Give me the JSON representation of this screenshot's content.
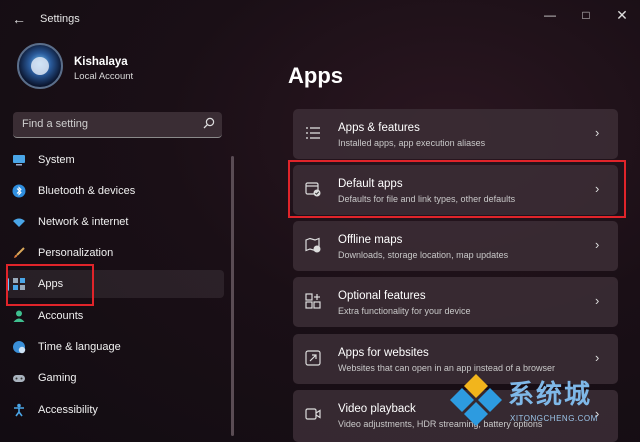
{
  "window": {
    "title": "Settings",
    "back_icon": "back-arrow-icon",
    "controls": [
      "minimize",
      "maximize",
      "close"
    ]
  },
  "profile": {
    "name": "Kishalaya",
    "account_type": "Local Account"
  },
  "search": {
    "placeholder": "Find a setting"
  },
  "nav": {
    "items": [
      {
        "label": "System",
        "icon": "monitor-icon",
        "selected": false
      },
      {
        "label": "Bluetooth & devices",
        "icon": "bluetooth-icon",
        "selected": false
      },
      {
        "label": "Network & internet",
        "icon": "wifi-icon",
        "selected": false
      },
      {
        "label": "Personalization",
        "icon": "brush-icon",
        "selected": false
      },
      {
        "label": "Apps",
        "icon": "apps-icon",
        "selected": true
      },
      {
        "label": "Accounts",
        "icon": "person-icon",
        "selected": false
      },
      {
        "label": "Time & language",
        "icon": "globe-clock-icon",
        "selected": false
      },
      {
        "label": "Gaming",
        "icon": "gamepad-icon",
        "selected": false
      },
      {
        "label": "Accessibility",
        "icon": "accessibility-icon",
        "selected": false
      }
    ]
  },
  "main": {
    "title": "Apps",
    "cards": [
      {
        "title": "Apps & features",
        "subtitle": "Installed apps, app execution aliases",
        "icon": "list-icon"
      },
      {
        "title": "Default apps",
        "subtitle": "Defaults for file and link types, other defaults",
        "icon": "default-apps-icon"
      },
      {
        "title": "Offline maps",
        "subtitle": "Downloads, storage location, map updates",
        "icon": "map-icon"
      },
      {
        "title": "Optional features",
        "subtitle": "Extra functionality for your device",
        "icon": "add-square-icon"
      },
      {
        "title": "Apps for websites",
        "subtitle": "Websites that can open in an app instead of a browser",
        "icon": "open-link-icon"
      },
      {
        "title": "Video playback",
        "subtitle": "Video adjustments, HDR streaming, battery options",
        "icon": "video-icon"
      }
    ]
  },
  "watermark": {
    "text": "系统城",
    "subtext": "XITONGCHENG.COM"
  },
  "colors": {
    "accent": "#6cc4ff",
    "highlight": "#e0242a"
  }
}
